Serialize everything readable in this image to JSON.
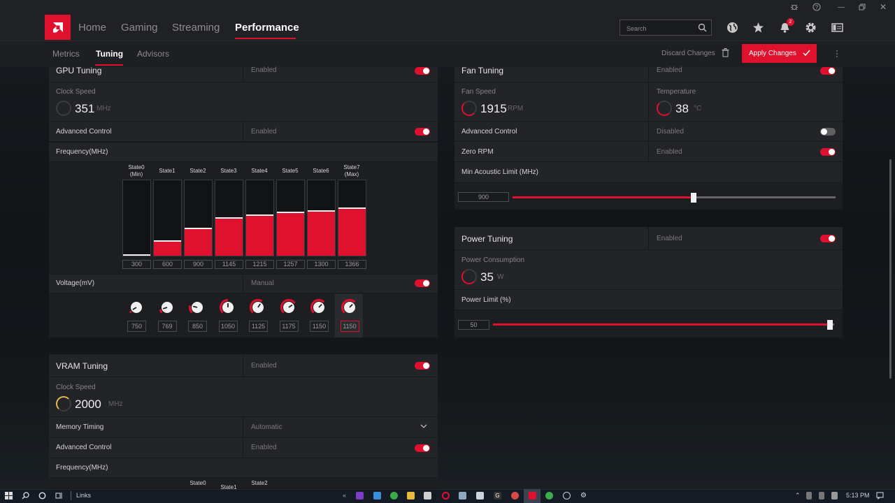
{
  "colors": {
    "accent": "#e0102f",
    "panel": "#232427",
    "topbar": "#202124"
  },
  "nav": {
    "home": "Home",
    "gaming": "Gaming",
    "streaming": "Streaming",
    "performance": "Performance"
  },
  "search": {
    "placeholder": "Search"
  },
  "notifications": {
    "count": "2"
  },
  "subnav": {
    "metrics": "Metrics",
    "tuning": "Tuning",
    "advisors": "Advisors",
    "discard": "Discard Changes",
    "apply": "Apply Changes"
  },
  "gpu": {
    "title": "GPU Tuning",
    "status": "Enabled",
    "clock_label": "Clock Speed",
    "clock_value": "351",
    "clock_unit": "MHz",
    "adv_label": "Advanced Control",
    "adv_status": "Enabled",
    "freq_label": "Frequency(MHz)",
    "states": [
      {
        "name": "State0",
        "sub": "(Min)",
        "value": "300",
        "fill": 0.02
      },
      {
        "name": "State1",
        "sub": "",
        "value": "600",
        "fill": 0.2
      },
      {
        "name": "State2",
        "sub": "",
        "value": "900",
        "fill": 0.37
      },
      {
        "name": "State3",
        "sub": "",
        "value": "1145",
        "fill": 0.51
      },
      {
        "name": "State4",
        "sub": "",
        "value": "1215",
        "fill": 0.55
      },
      {
        "name": "State5",
        "sub": "",
        "value": "1257",
        "fill": 0.58
      },
      {
        "name": "State6",
        "sub": "",
        "value": "1300",
        "fill": 0.6
      },
      {
        "name": "State7",
        "sub": "(Max)",
        "value": "1366",
        "fill": 0.64
      }
    ],
    "volt_label": "Voltage(mV)",
    "volt_status": "Manual",
    "voltages": [
      {
        "value": "750",
        "level": 0.05
      },
      {
        "value": "769",
        "level": 0.1
      },
      {
        "value": "850",
        "level": 0.22
      },
      {
        "value": "1050",
        "level": 0.5
      },
      {
        "value": "1125",
        "level": 0.62
      },
      {
        "value": "1175",
        "level": 0.7
      },
      {
        "value": "1150",
        "level": 0.66
      },
      {
        "value": "1150",
        "level": 0.66
      }
    ]
  },
  "vram": {
    "title": "VRAM Tuning",
    "status": "Enabled",
    "clock_label": "Clock Speed",
    "clock_value": "2000",
    "clock_unit": "MHz",
    "mem_label": "Memory Timing",
    "mem_value": "Automatic",
    "adv_label": "Advanced Control",
    "adv_status": "Enabled",
    "freq_label": "Frequency(MHz)",
    "states": [
      "State0",
      "State1",
      "State2"
    ]
  },
  "fan": {
    "title": "Fan Tuning",
    "status": "Enabled",
    "speed_label": "Fan Speed",
    "speed_value": "1915",
    "speed_unit": "RPM",
    "temp_label": "Temperature",
    "temp_value": "38",
    "temp_unit": "°C",
    "adv_label": "Advanced Control",
    "adv_status": "Disabled",
    "zero_label": "Zero RPM",
    "zero_status": "Enabled",
    "acoustic_label": "Min Acoustic Limit (MHz)",
    "acoustic_value": "900",
    "acoustic_level": 0.56
  },
  "power": {
    "title": "Power Tuning",
    "status": "Enabled",
    "cons_label": "Power Consumption",
    "cons_value": "35",
    "cons_unit": "W",
    "limit_label": "Power Limit (%)",
    "limit_value": "50",
    "limit_level": 1.0
  },
  "taskbar": {
    "links": "Links",
    "time": "5:13 PM"
  }
}
